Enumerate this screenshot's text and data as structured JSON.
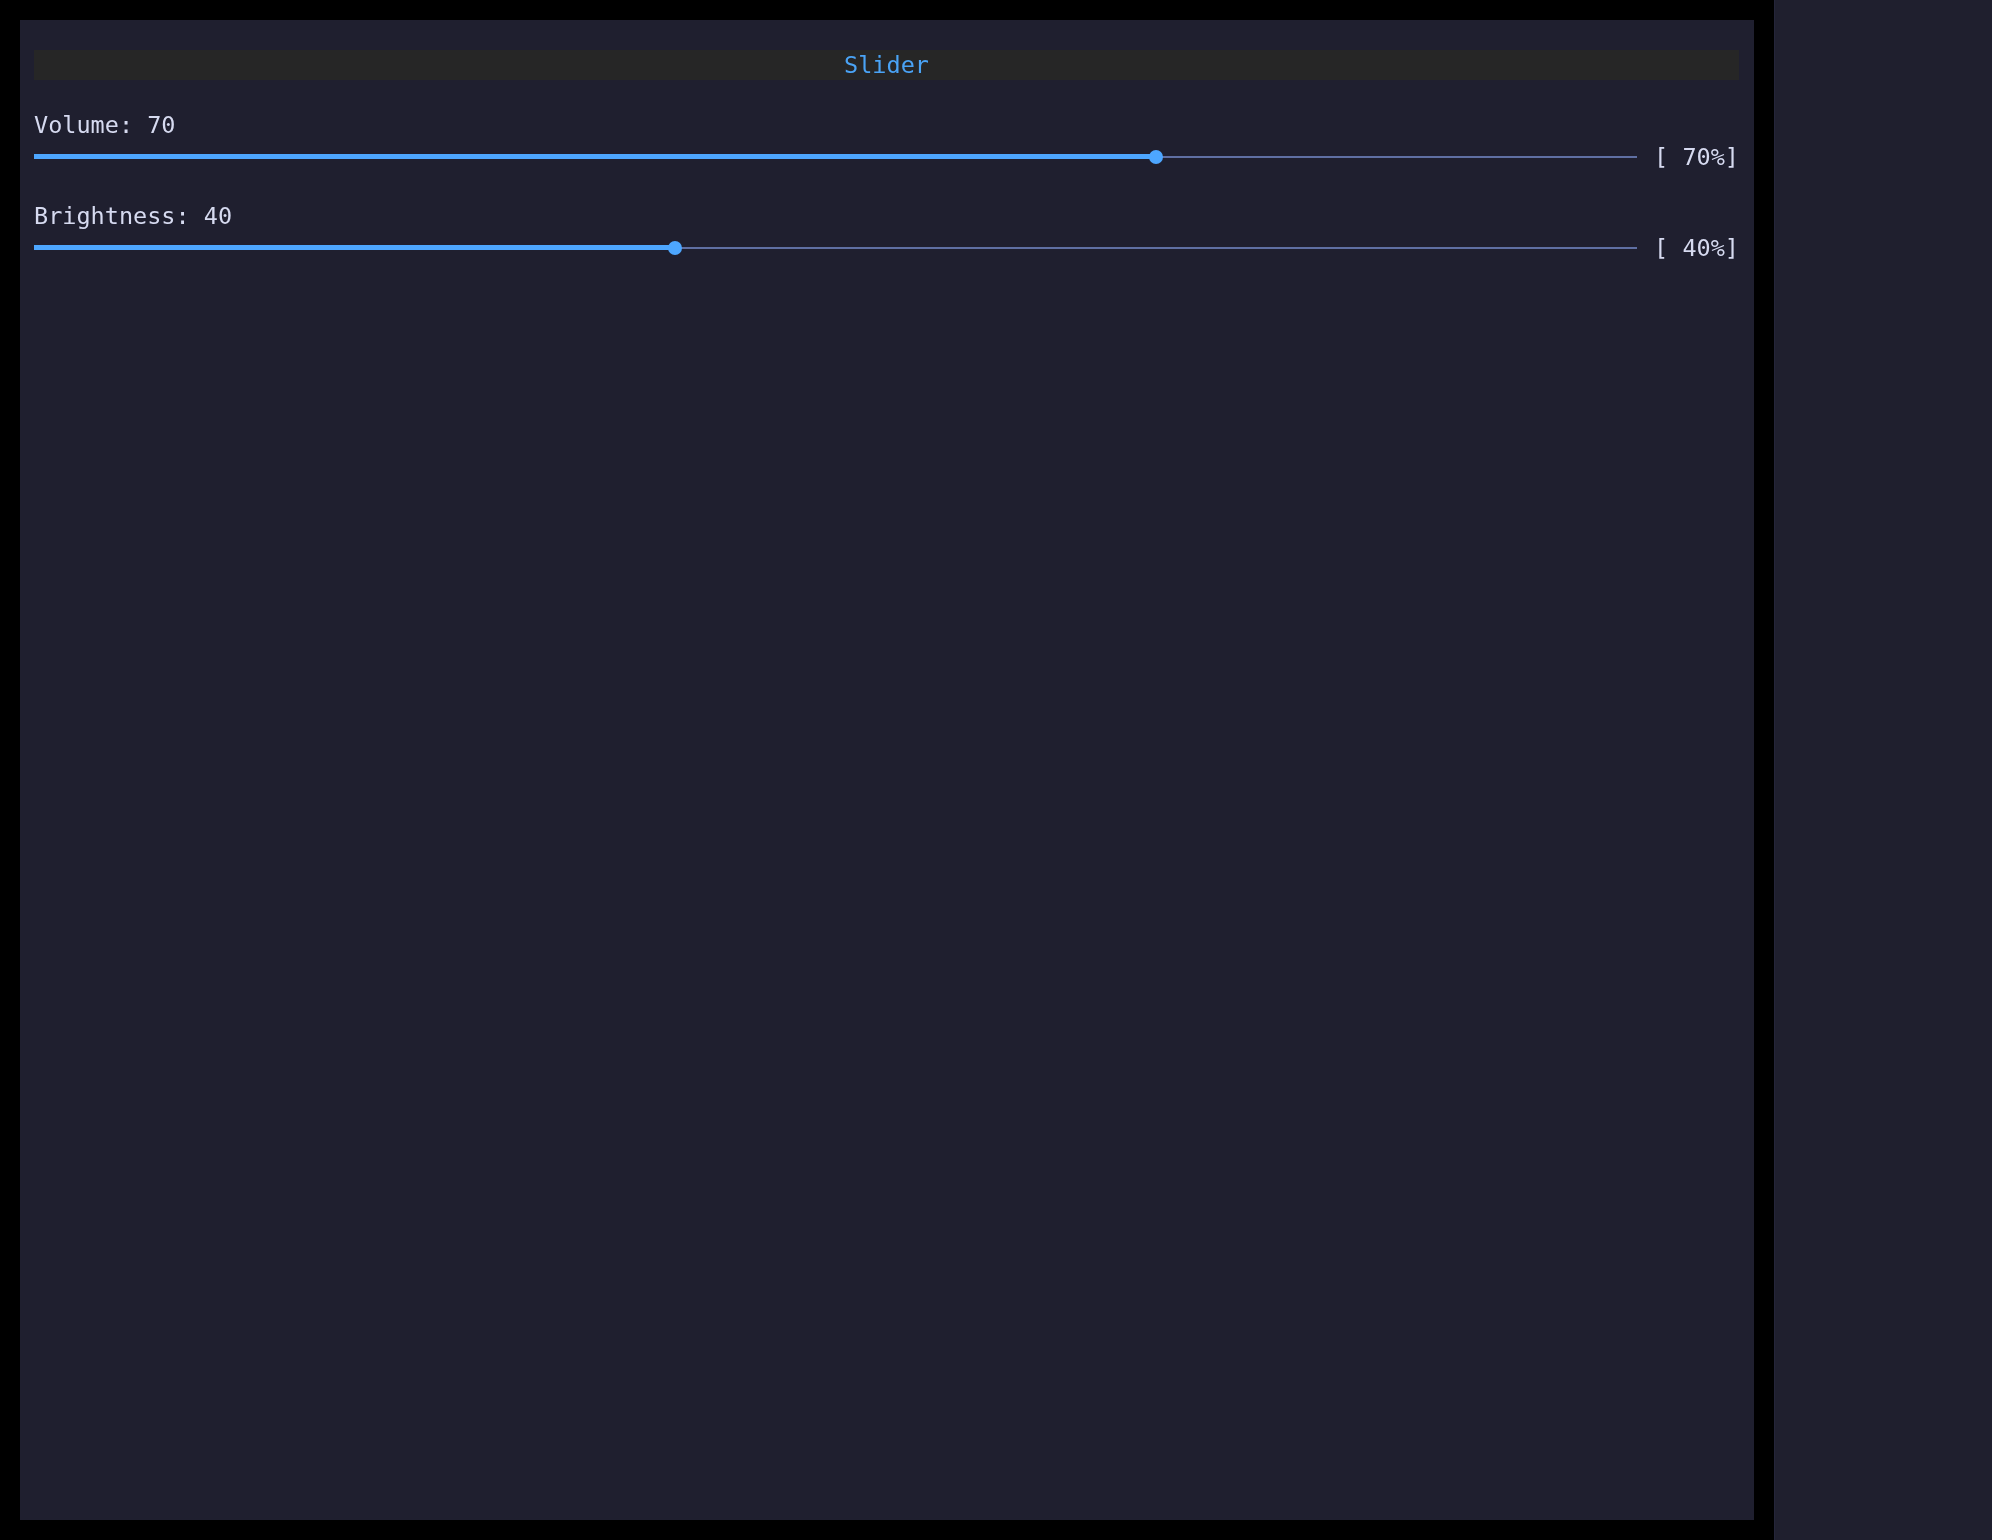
{
  "title": "Slider",
  "sliders": [
    {
      "label": "Volume: 70",
      "level": 0.7,
      "reading": "[ 70%]"
    },
    {
      "label": "Brightness: 40",
      "level": 0.4,
      "reading": "[ 40%]"
    }
  ]
}
